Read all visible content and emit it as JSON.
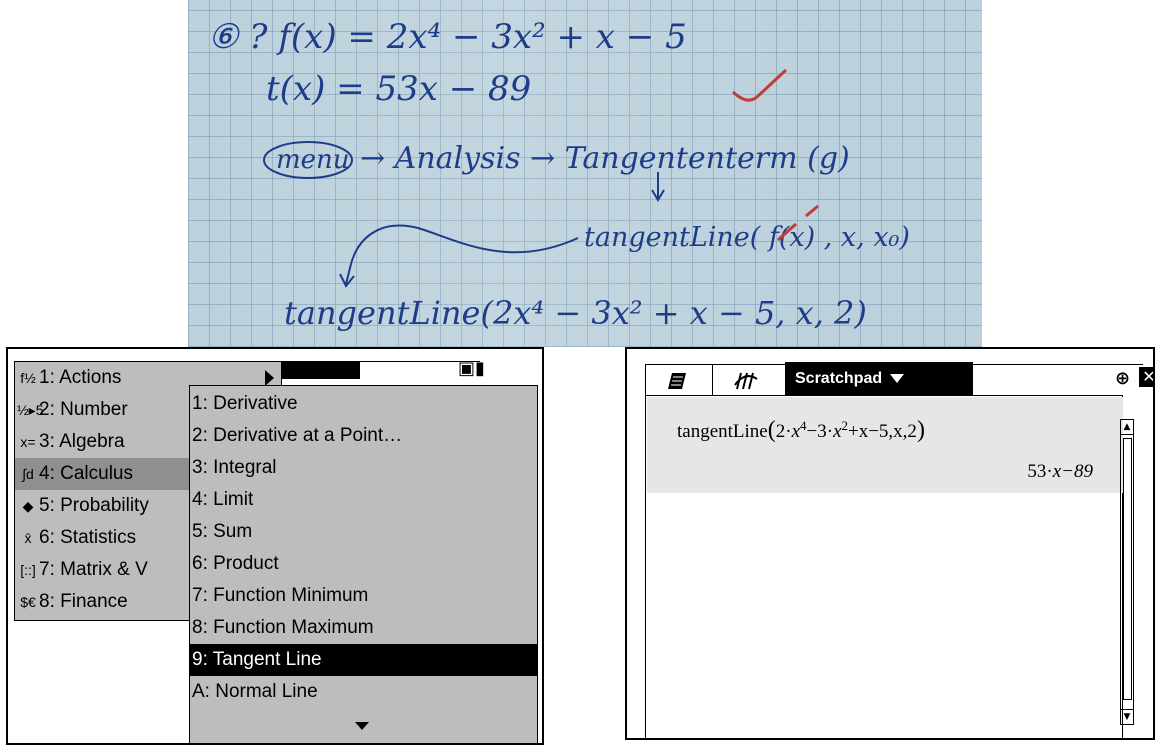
{
  "note": {
    "line1": "⑥  ? f(x) = 2x⁴ − 3x² + x − 5",
    "line2": "t(x) = 53x − 89",
    "line3": "→ Analysis → Tangententerm (g)",
    "line3_menu": "menu",
    "line4": "tangentLine( f(x) , x, x₀)",
    "line5": "tangentLine(2x⁴ − 3x² + x − 5, x, 2)"
  },
  "main_menu": {
    "items": [
      {
        "icon": "f½",
        "label": "1: Actions"
      },
      {
        "icon": "½▸5",
        "label": "2: Number"
      },
      {
        "icon": "x=",
        "label": "3: Algebra"
      },
      {
        "icon": "∫d",
        "label": "4: Calculus"
      },
      {
        "icon": "◆",
        "label": "5: Probability"
      },
      {
        "icon": "x̄",
        "label": "6: Statistics"
      },
      {
        "icon": "[::]",
        "label": "7: Matrix & V"
      },
      {
        "icon": "$€",
        "label": "8: Finance"
      }
    ]
  },
  "sub_menu": {
    "items": [
      "1: Derivative",
      "2: Derivative at a Point…",
      "3: Integral",
      "4: Limit",
      "5: Sum",
      "6: Product",
      "7: Function Minimum",
      "8: Function Maximum",
      "9: Tangent Line",
      "A: Normal Line"
    ],
    "selected": "9: Tangent Line"
  },
  "scratchpad": {
    "tab_label": "Scratchpad",
    "input": {
      "fn": "tangentLine",
      "coef1": "2",
      "exp1": "4",
      "mid": "−3",
      "exp2": "2",
      "tail": "+x−5,x,2"
    },
    "output": {
      "coef": "53",
      "rest": "x−89"
    },
    "close_label": "✕"
  }
}
